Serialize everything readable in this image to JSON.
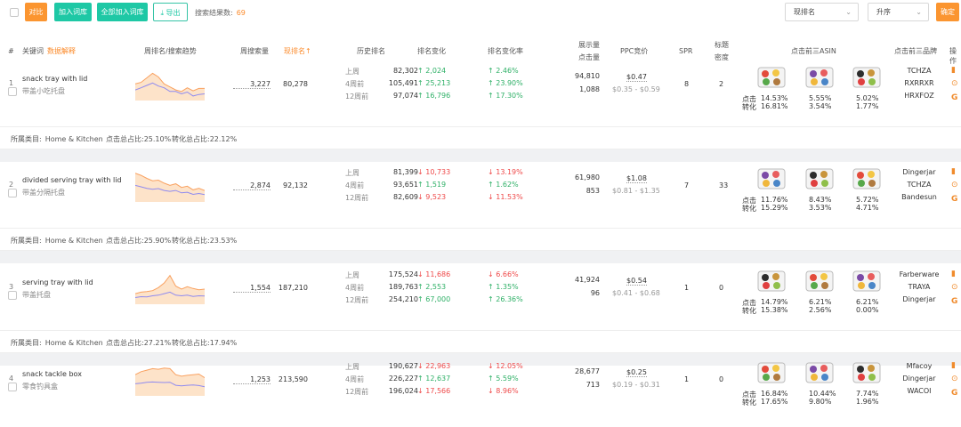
{
  "toolbar": {
    "compare": "对比",
    "add_to_library": "加入词库",
    "add_all_to_library": "全部加入词库",
    "export": "导出",
    "result_label": "搜索结果数:",
    "result_count": "69",
    "sort_field": "现排名",
    "sort_order": "升序",
    "confirm": "确定"
  },
  "header": {
    "keyword": "关键词",
    "data_explain": "数据解释",
    "weekly_rank_trend": "周排名/搜索趋势",
    "weekly_search_volume": "周搜索量",
    "current_rank": "现排名",
    "current_rank_arrow": "↑",
    "history_rank": "历史排名",
    "rank_change": "排名变化",
    "rank_change_rate": "排名变化率",
    "impressions": "展示量",
    "clicks": "点击量",
    "ppc_bid": "PPC竞价",
    "spr": "SPR",
    "title_l1": "标题",
    "title_l2": "密度",
    "top3_asin": "点击前三ASIN",
    "top3_brand": "点击前三品牌",
    "actions": "操作"
  },
  "labels": {
    "last_week": "上周",
    "four_weeks": "4周前",
    "twelve_weeks": "12周前",
    "click": "点击",
    "conversion": "转化",
    "category_prefix": "所属类目:",
    "click_share_prefix": "点击总占比:",
    "conv_share_prefix": "转化总占比:"
  },
  "rows": [
    {
      "index": "1",
      "keyword": "snack tray with lid",
      "keyword_cn": "带盖小吃托盘",
      "search_volume": "3,227",
      "current_rank": "80,278",
      "history": [
        "82,302",
        "105,491",
        "97,074"
      ],
      "change": [
        "↑ 2,024",
        "↑ 25,213",
        "↑ 16,796"
      ],
      "change_dir": [
        "up",
        "up",
        "up"
      ],
      "rate": [
        "↑ 2.46%",
        "↑ 23.90%",
        "↑ 17.30%"
      ],
      "impressions": "94,810",
      "clicks": "1,088",
      "ppc": "$0.47",
      "ppc_range": "$0.35 - $0.59",
      "spr": "8",
      "title_density": "2",
      "asin_clicks": [
        "14.53%",
        "5.55%",
        "5.02%"
      ],
      "asin_conv": [
        "16.81%",
        "3.54%",
        "1.77%"
      ],
      "brands": [
        "TCHZA",
        "RXRRXR",
        "HRXFOZ"
      ],
      "category": "Home & Kitchen",
      "click_share": "25.10%",
      "conv_share": "22.12%",
      "trend_rank": [
        0.55,
        0.6,
        0.75,
        0.9,
        0.78,
        0.55,
        0.45,
        0.35,
        0.3,
        0.42,
        0.32,
        0.4,
        0.4
      ],
      "trend_search": [
        0.35,
        0.42,
        0.5,
        0.58,
        0.48,
        0.42,
        0.3,
        0.3,
        0.22,
        0.28,
        0.15,
        0.2,
        0.22
      ]
    },
    {
      "index": "2",
      "keyword": "divided serving tray with lid",
      "keyword_cn": "带盖分隔托盘",
      "search_volume": "2,874",
      "current_rank": "92,132",
      "history": [
        "81,399",
        "93,651",
        "82,609"
      ],
      "change": [
        "↓ 10,733",
        "↑ 1,519",
        "↓ 9,523"
      ],
      "change_dir": [
        "down",
        "up",
        "down"
      ],
      "rate": [
        "↓ 13.19%",
        "↑ 1.62%",
        "↓ 11.53%"
      ],
      "impressions": "61,980",
      "clicks": "853",
      "ppc": "$1.08",
      "ppc_range": "$0.81 - $1.35",
      "spr": "7",
      "title_density": "33",
      "asin_clicks": [
        "11.76%",
        "8.43%",
        "5.72%"
      ],
      "asin_conv": [
        "15.29%",
        "3.53%",
        "4.71%"
      ],
      "brands": [
        "Dingerjar",
        "TCHZA",
        "Bandesun"
      ],
      "category": "Home & Kitchen",
      "click_share": "25.90%",
      "conv_share": "23.53%",
      "trend_rank": [
        0.95,
        0.88,
        0.78,
        0.7,
        0.72,
        0.62,
        0.55,
        0.6,
        0.48,
        0.52,
        0.4,
        0.45,
        0.38
      ],
      "trend_search": [
        0.55,
        0.5,
        0.45,
        0.42,
        0.44,
        0.38,
        0.35,
        0.38,
        0.3,
        0.32,
        0.25,
        0.28,
        0.24
      ]
    },
    {
      "index": "3",
      "keyword": "serving tray with lid",
      "keyword_cn": "带盖托盘",
      "search_volume": "1,554",
      "current_rank": "187,210",
      "history": [
        "175,524",
        "189,763",
        "254,210"
      ],
      "change": [
        "↓ 11,686",
        "↑ 2,553",
        "↑ 67,000"
      ],
      "change_dir": [
        "down",
        "up",
        "up"
      ],
      "rate": [
        "↓ 6.66%",
        "↑ 1.35%",
        "↑ 26.36%"
      ],
      "impressions": "41,924",
      "clicks": "96",
      "ppc": "$0.54",
      "ppc_range": "$0.41 - $0.68",
      "spr": "1",
      "title_density": "0",
      "asin_clicks": [
        "14.79%",
        "6.21%",
        "6.21%"
      ],
      "asin_conv": [
        "15.38%",
        "2.56%",
        "0.00%"
      ],
      "brands": [
        "Farberware",
        "TRAYA",
        "Dingerjar"
      ],
      "category": "Home & Kitchen",
      "click_share": "27.21%",
      "conv_share": "17.94%",
      "trend_rank": [
        0.35,
        0.4,
        0.42,
        0.45,
        0.55,
        0.7,
        0.95,
        0.6,
        0.5,
        0.58,
        0.52,
        0.48,
        0.5
      ],
      "trend_search": [
        0.22,
        0.25,
        0.24,
        0.28,
        0.3,
        0.35,
        0.4,
        0.3,
        0.28,
        0.3,
        0.26,
        0.28,
        0.27
      ]
    },
    {
      "index": "4",
      "keyword": "snack tackle box",
      "keyword_cn": "零食钓具盒",
      "search_volume": "1,253",
      "current_rank": "213,590",
      "history": [
        "190,627",
        "226,227",
        "196,024"
      ],
      "change": [
        "↓ 22,963",
        "↑ 12,637",
        "↓ 17,566"
      ],
      "change_dir": [
        "down",
        "up",
        "down"
      ],
      "rate": [
        "↓ 12.05%",
        "↑ 5.59%",
        "↓ 8.96%"
      ],
      "impressions": "28,677",
      "clicks": "713",
      "ppc": "$0.25",
      "ppc_range": "$0.19 - $0.31",
      "spr": "1",
      "title_density": "0",
      "asin_clicks": [
        "16.84%",
        "10.44%",
        "7.74%"
      ],
      "asin_conv": [
        "17.65%",
        "9.80%",
        "1.96%"
      ],
      "brands": [
        "Mfacoy",
        "Dingerjar",
        "WACOI"
      ],
      "category": "",
      "click_share": "",
      "conv_share": "",
      "trend_rank": [
        0.7,
        0.8,
        0.85,
        0.9,
        0.88,
        0.92,
        0.9,
        0.7,
        0.65,
        0.68,
        0.7,
        0.72,
        0.6
      ],
      "trend_search": [
        0.4,
        0.42,
        0.45,
        0.46,
        0.45,
        0.44,
        0.45,
        0.35,
        0.33,
        0.35,
        0.36,
        0.34,
        0.3
      ]
    }
  ],
  "colors": {
    "accent": "#fb9530",
    "teal": "#1ec8a5",
    "up": "#2fb067",
    "down": "#ef4a4a",
    "trend_line": "#f9a160",
    "trend_fill": "#fde3c9",
    "search_line": "#8f8af0"
  },
  "icons": [
    "trend-icon",
    "more-icon",
    "google-icon",
    "download-icon"
  ]
}
